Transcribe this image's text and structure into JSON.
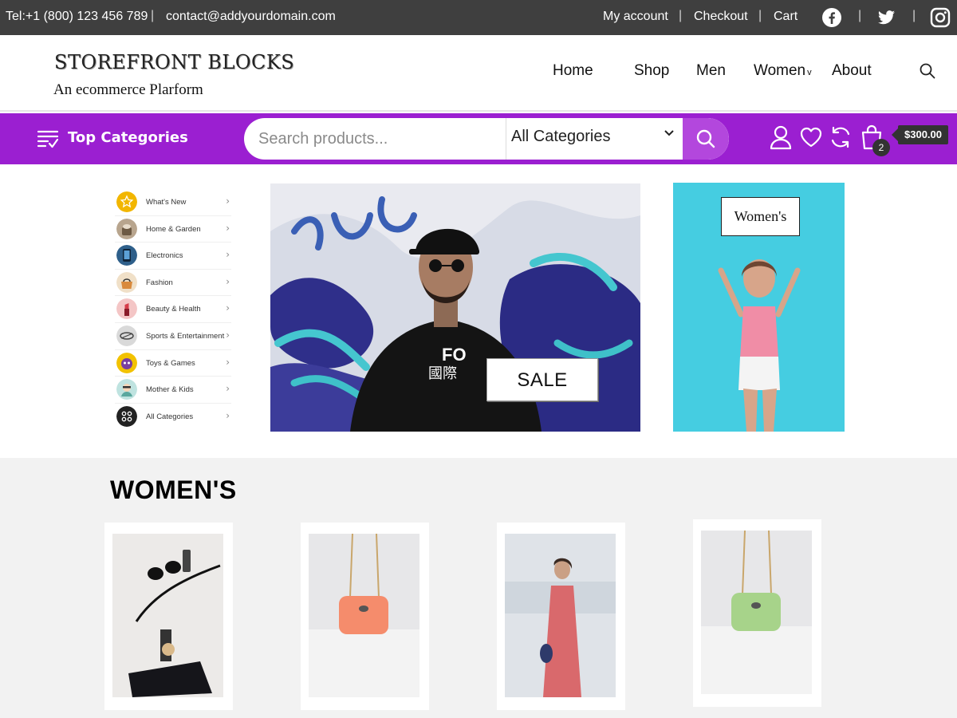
{
  "topbar": {
    "phone": "Tel:+1 (800) 123 456 789",
    "email": "contact@addyourdomain.com",
    "links": [
      "My account",
      "Checkout",
      "Cart"
    ],
    "social": [
      "facebook-icon",
      "twitter-icon",
      "instagram-icon"
    ]
  },
  "brand": {
    "title": "STOREFRONT BLOCKS",
    "tagline": "An ecommerce Plarform"
  },
  "nav": {
    "items": [
      "Home",
      "Shop",
      "Men",
      "Women",
      "About"
    ],
    "women_caret": "v"
  },
  "categorybar": {
    "label": "Top Categories",
    "search_placeholder": "Search products...",
    "category_selected": "All Categories",
    "cart_count": "2",
    "cart_total": "$300.00",
    "accent": "#9b1fd1"
  },
  "categories": [
    {
      "label": "What's New",
      "color": "#f2b600"
    },
    {
      "label": "Home & Garden",
      "color": "#b8a58e"
    },
    {
      "label": "Electronics",
      "color": "#2e5f8a"
    },
    {
      "label": "Fashion",
      "color": "#f0e0c8"
    },
    {
      "label": "Beauty & Health",
      "color": "#f4c6c6"
    },
    {
      "label": "Sports & Entertainment",
      "color": "#d9d9d9"
    },
    {
      "label": "Toys & Games",
      "color": "#f2c200"
    },
    {
      "label": "Mother & Kids",
      "color": "#bfe3e0"
    },
    {
      "label": "All Categories",
      "color": "#222222"
    }
  ],
  "hero": {
    "sale_label": "SALE",
    "side_label": "Women's"
  },
  "womens": {
    "title": "WOMEN'S"
  }
}
